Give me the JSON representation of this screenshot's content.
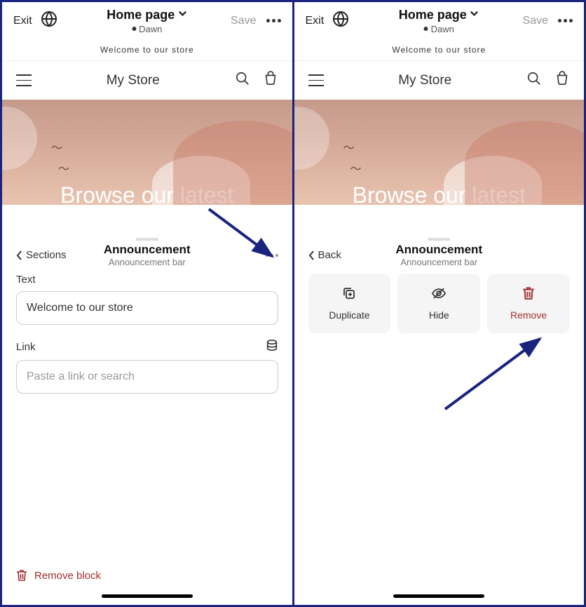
{
  "topbar": {
    "exit": "Exit",
    "page_title": "Home page",
    "theme": "Dawn",
    "save": "Save"
  },
  "announce_banner": "Welcome to our store",
  "store": {
    "name": "My Store",
    "hero_text": "Browse our latest"
  },
  "left_sheet": {
    "back_label": "Sections",
    "title": "Announcement",
    "subtitle": "Announcement bar",
    "text_label": "Text",
    "text_value": "Welcome to our store",
    "link_label": "Link",
    "link_placeholder": "Paste a link or search",
    "remove_block": "Remove block"
  },
  "right_sheet": {
    "back_label": "Back",
    "title": "Announcement",
    "subtitle": "Announcement bar",
    "actions": {
      "duplicate": "Duplicate",
      "hide": "Hide",
      "remove": "Remove"
    }
  }
}
